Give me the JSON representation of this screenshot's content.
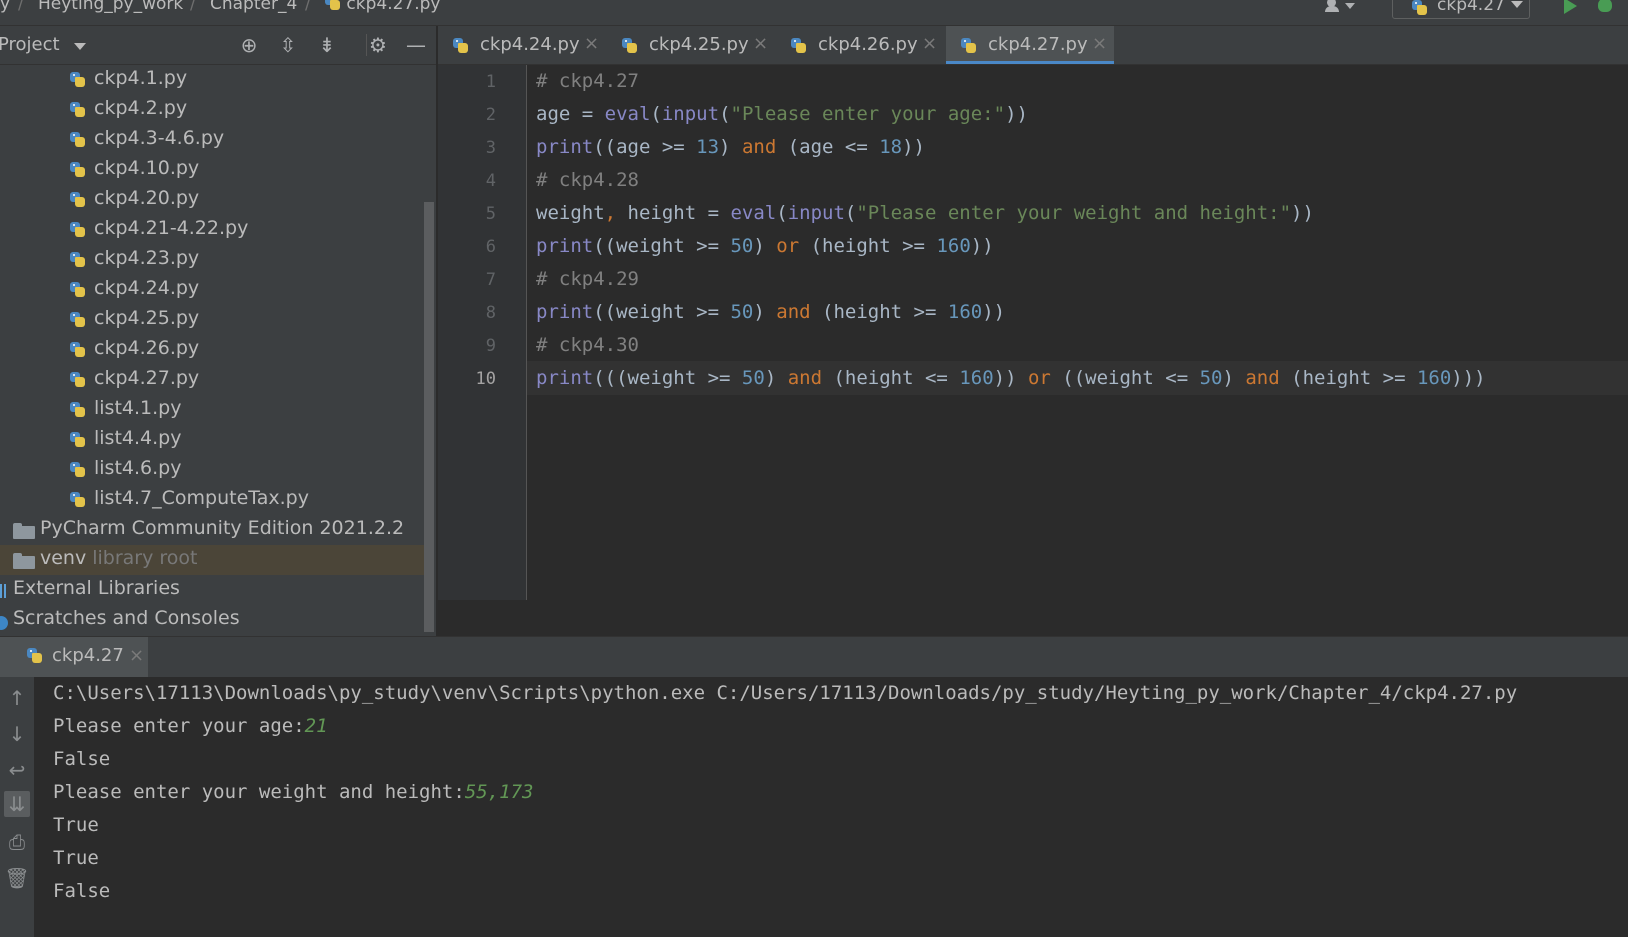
{
  "navbar": {
    "crumbs": [
      "y",
      "Heyting_py_work",
      "Chapter_4",
      "ckp4.27.py"
    ],
    "run_config": "ckp4.27"
  },
  "project": {
    "title": "Project",
    "files": [
      "ckp4.1.py",
      "ckp4.2.py",
      "ckp4.3-4.6.py",
      "ckp4.10.py",
      "ckp4.20.py",
      "ckp4.21-4.22.py",
      "ckp4.23.py",
      "ckp4.24.py",
      "ckp4.25.py",
      "ckp4.26.py",
      "ckp4.27.py",
      "list4.1.py",
      "list4.4.py",
      "list4.6.py",
      "list4.7_ComputeTax.py"
    ],
    "folder_pycharm": "PyCharm Community Edition 2021.2.2",
    "folder_venv": "venv",
    "venv_hint": "library root",
    "external_libraries": "External Libraries",
    "scratches": "Scratches and Consoles"
  },
  "tabs": [
    "ckp4.24.py",
    "ckp4.25.py",
    "ckp4.26.py",
    "ckp4.27.py"
  ],
  "active_tab": "ckp4.27.py",
  "editor": {
    "line_numbers": [
      "1",
      "2",
      "3",
      "4",
      "5",
      "6",
      "7",
      "8",
      "9",
      "10"
    ],
    "current_line": "10"
  },
  "run": {
    "tab_label": "ckp4.27",
    "command": "C:\\Users\\17113\\Downloads\\py_study\\venv\\Scripts\\python.exe C:/Users/17113/Downloads/py_study/Heyting_py_work/Chapter_4/ckp4.27.py",
    "prompt_age": "Please enter your age:",
    "input_age": "21",
    "out1": "False",
    "prompt_wh": "Please enter your weight and height:",
    "input_wh": "55,173",
    "out2": "True",
    "out3": "True",
    "out4": "False"
  },
  "colors": {
    "background": "#2b2b2b",
    "panel": "#3c3f41",
    "keyword": "#cc7832",
    "string": "#6a8759",
    "number": "#6897bb",
    "builtin": "#8888c6",
    "comment": "#808080",
    "input": "#629755"
  }
}
